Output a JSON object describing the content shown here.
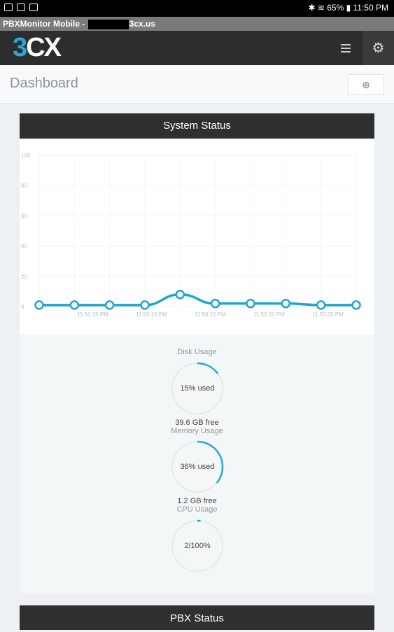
{
  "status_bar": {
    "right_text": "✱ ≋ 65% ▮ 11:50 PM"
  },
  "title_bar": {
    "prefix": "PBXMonitor Mobile -",
    "suffix": "3cx.us"
  },
  "header": {
    "logo_num": "3",
    "logo_text": "CX"
  },
  "dashboard": {
    "title": "Dashboard"
  },
  "system_status": {
    "title": "System Status"
  },
  "chart_data": {
    "type": "line",
    "yticks": [
      "100",
      "80",
      "60",
      "40",
      "20",
      "0"
    ],
    "ylim": [
      0,
      100
    ],
    "x_tick_labels": [
      "11:50:15 PM",
      "11:50:10 PM",
      "11:50:15 PM",
      "11:50:20 PM",
      "11:50:25 PM"
    ],
    "values": [
      1,
      1,
      1,
      1,
      8,
      2,
      2,
      2,
      1,
      1
    ],
    "color": "#1fa5d1"
  },
  "gauges": [
    {
      "label": "Disk Usage",
      "value_text": "15% used",
      "percent": 15,
      "free": "39.6 GB free"
    },
    {
      "label": "Memory Usage",
      "value_text": "36% used",
      "percent": 36,
      "free": "1.2 GB free"
    },
    {
      "label": "CPU Usage",
      "value_text": "2/100%",
      "percent": 2,
      "free": ""
    }
  ],
  "pbx_status": {
    "title": "PBX Status"
  },
  "colors": {
    "accent": "#27a8d8",
    "header": "#2d2d2d"
  }
}
